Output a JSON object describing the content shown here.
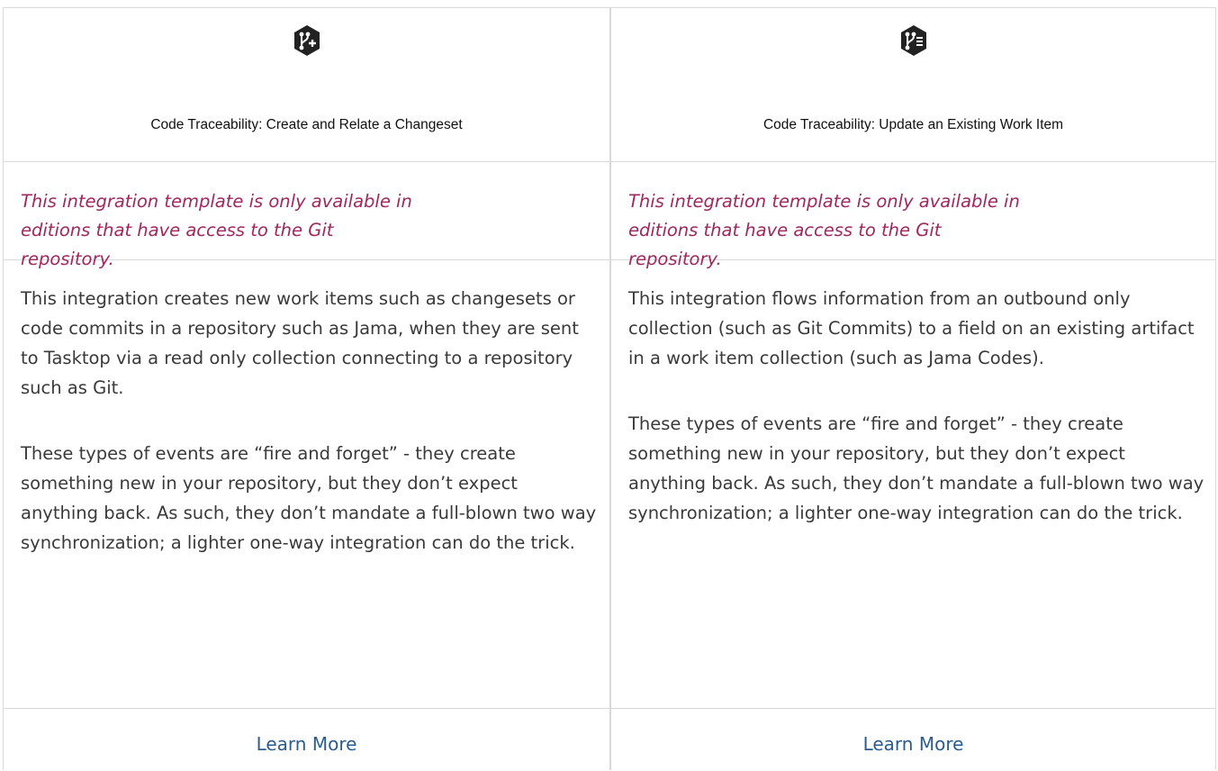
{
  "columns": [
    {
      "icon": "git-branch-plus-icon",
      "title": "Code Traceability: Create and Relate a Changeset",
      "note": "This integration template is only available in editions that have access to the Git repository.",
      "paragraphs": [
        "This integration creates new work items such as changesets or code commits in a repository such as Jama, when they are sent to Tasktop via a read only collection connecting to a repository such as Git.",
        "These types of events are “fire and forget” - they create something new in your repository, but they don’t expect anything back. As such, they don’t mandate a full-blown two way synchronization; a lighter one-way integration can do the trick."
      ],
      "link": "Learn More"
    },
    {
      "icon": "git-branch-list-icon",
      "title": "Code Traceability: Update an Existing Work Item",
      "note": "This integration template is only available in editions that have access to the Git repository.",
      "paragraphs": [
        "This integration flows information from an outbound only collection (such as Git Commits) to a field on an existing artifact in a work item collection (such as Jama Codes).",
        "These types of events are “fire and forget” - they create something new in your repository, but they don’t expect anything back. As such, they don’t mandate a full-blown two way synchronization; a lighter one-way integration can do the trick."
      ],
      "link": "Learn More"
    }
  ],
  "colors": {
    "note": "#a0275f",
    "link": "#2b5c8f",
    "border": "#d9d9d9",
    "icon": "#222222"
  }
}
